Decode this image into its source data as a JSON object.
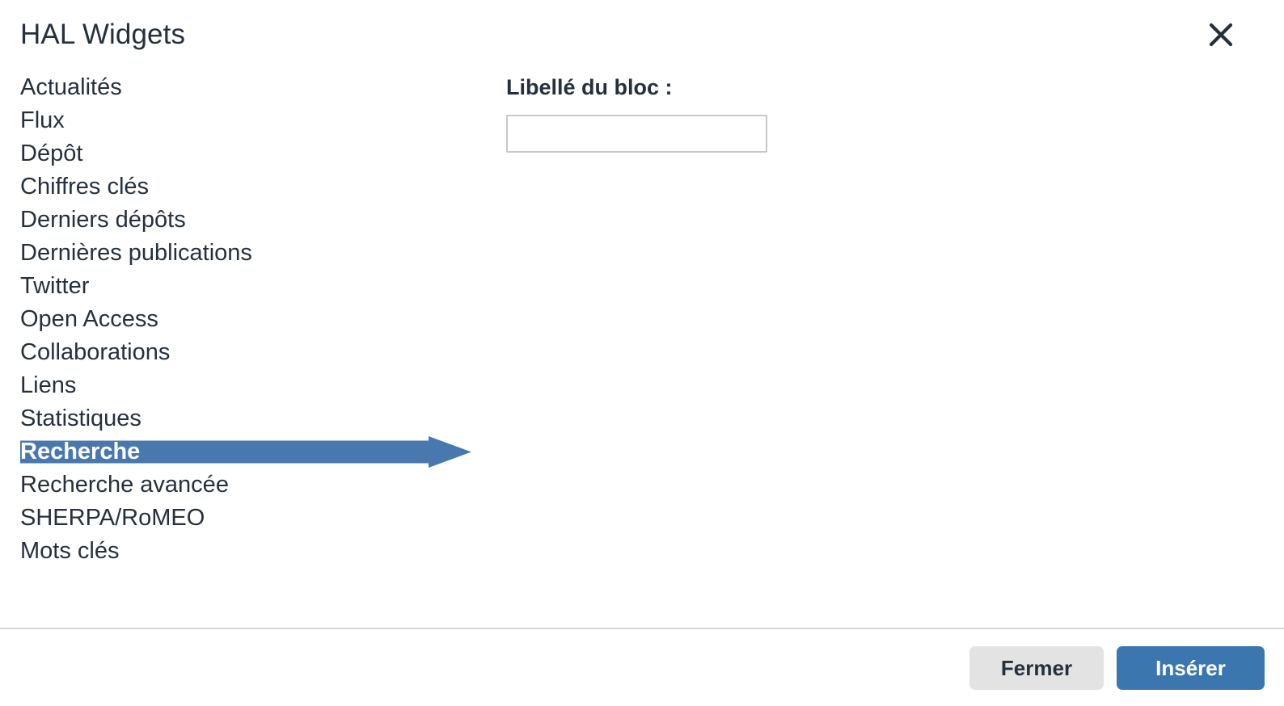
{
  "modal": {
    "title": "HAL Widgets",
    "close_icon": "close-icon",
    "close_label": "×"
  },
  "widgets": {
    "items": [
      {
        "label": "Actualités",
        "selected": false
      },
      {
        "label": "Flux",
        "selected": false
      },
      {
        "label": "Dépôt",
        "selected": false
      },
      {
        "label": "Chiffres clés",
        "selected": false
      },
      {
        "label": "Derniers dépôts",
        "selected": false
      },
      {
        "label": "Dernières publications",
        "selected": false
      },
      {
        "label": "Twitter",
        "selected": false
      },
      {
        "label": "Open Access",
        "selected": false
      },
      {
        "label": "Collaborations",
        "selected": false
      },
      {
        "label": "Liens",
        "selected": false
      },
      {
        "label": "Statistiques",
        "selected": false
      },
      {
        "label": "Recherche",
        "selected": true
      },
      {
        "label": "Recherche avancée",
        "selected": false
      },
      {
        "label": "SHERPA/RoMEO",
        "selected": false
      },
      {
        "label": "Mots clés",
        "selected": false
      }
    ],
    "selected_label": "Recherche",
    "selection_highlight_color": "#4878ae",
    "selection_marker": "right-arrow-highlight"
  },
  "form": {
    "block_label_caption": "Libellé du bloc :",
    "block_label_value": "",
    "block_label_placeholder": ""
  },
  "footer": {
    "close_button_label": "Fermer",
    "insert_button_label": "Insérer",
    "insert_button_color": "#3b77ae",
    "close_button_color": "#e3e3e3"
  },
  "colors": {
    "text": "#26303d",
    "accent": "#4878ae",
    "border": "#d6d6d6",
    "input_border": "#c8c8c8",
    "background": "#ffffff"
  }
}
